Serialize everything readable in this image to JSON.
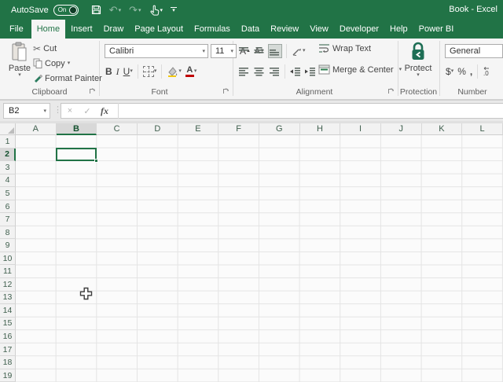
{
  "titlebar": {
    "autosave_label": "AutoSave",
    "autosave_state": "On",
    "window_title": "Book  -  Excel"
  },
  "tabs": [
    {
      "label": "File",
      "active": false
    },
    {
      "label": "Home",
      "active": true
    },
    {
      "label": "Insert",
      "active": false
    },
    {
      "label": "Draw",
      "active": false
    },
    {
      "label": "Page Layout",
      "active": false
    },
    {
      "label": "Formulas",
      "active": false
    },
    {
      "label": "Data",
      "active": false
    },
    {
      "label": "Review",
      "active": false
    },
    {
      "label": "View",
      "active": false
    },
    {
      "label": "Developer",
      "active": false
    },
    {
      "label": "Help",
      "active": false
    },
    {
      "label": "Power BI",
      "active": false
    }
  ],
  "ribbon": {
    "clipboard": {
      "label": "Clipboard",
      "paste": "Paste",
      "cut": "Cut",
      "copy": "Copy",
      "format_painter": "Format Painter"
    },
    "font": {
      "label": "Font",
      "font_name": "Calibri",
      "font_size": "11",
      "bold": "B",
      "italic": "I",
      "underline": "U"
    },
    "alignment": {
      "label": "Alignment",
      "wrap_text": "Wrap Text",
      "merge_center": "Merge & Center"
    },
    "protection": {
      "label": "Protection",
      "protect": "Protect"
    },
    "number": {
      "label": "Number",
      "format": "General",
      "currency": "$",
      "percent": "%",
      "comma": ","
    }
  },
  "formula_bar": {
    "name_box": "B2",
    "cancel": "×",
    "enter": "✓",
    "fx": "fx",
    "formula": ""
  },
  "grid": {
    "columns": [
      "A",
      "B",
      "C",
      "D",
      "E",
      "F",
      "G",
      "H",
      "I",
      "J",
      "K",
      "L"
    ],
    "rows": [
      "1",
      "2",
      "3",
      "4",
      "5",
      "6",
      "7",
      "8",
      "9",
      "10",
      "11",
      "12",
      "13",
      "14",
      "15",
      "16",
      "17",
      "18",
      "19"
    ],
    "selected_cell": "B2",
    "selected_column": "B",
    "selected_row": "2"
  },
  "colors": {
    "excel_green": "#217346",
    "selection_border": "#217346",
    "ribbon_bg": "#f5f5f5"
  }
}
